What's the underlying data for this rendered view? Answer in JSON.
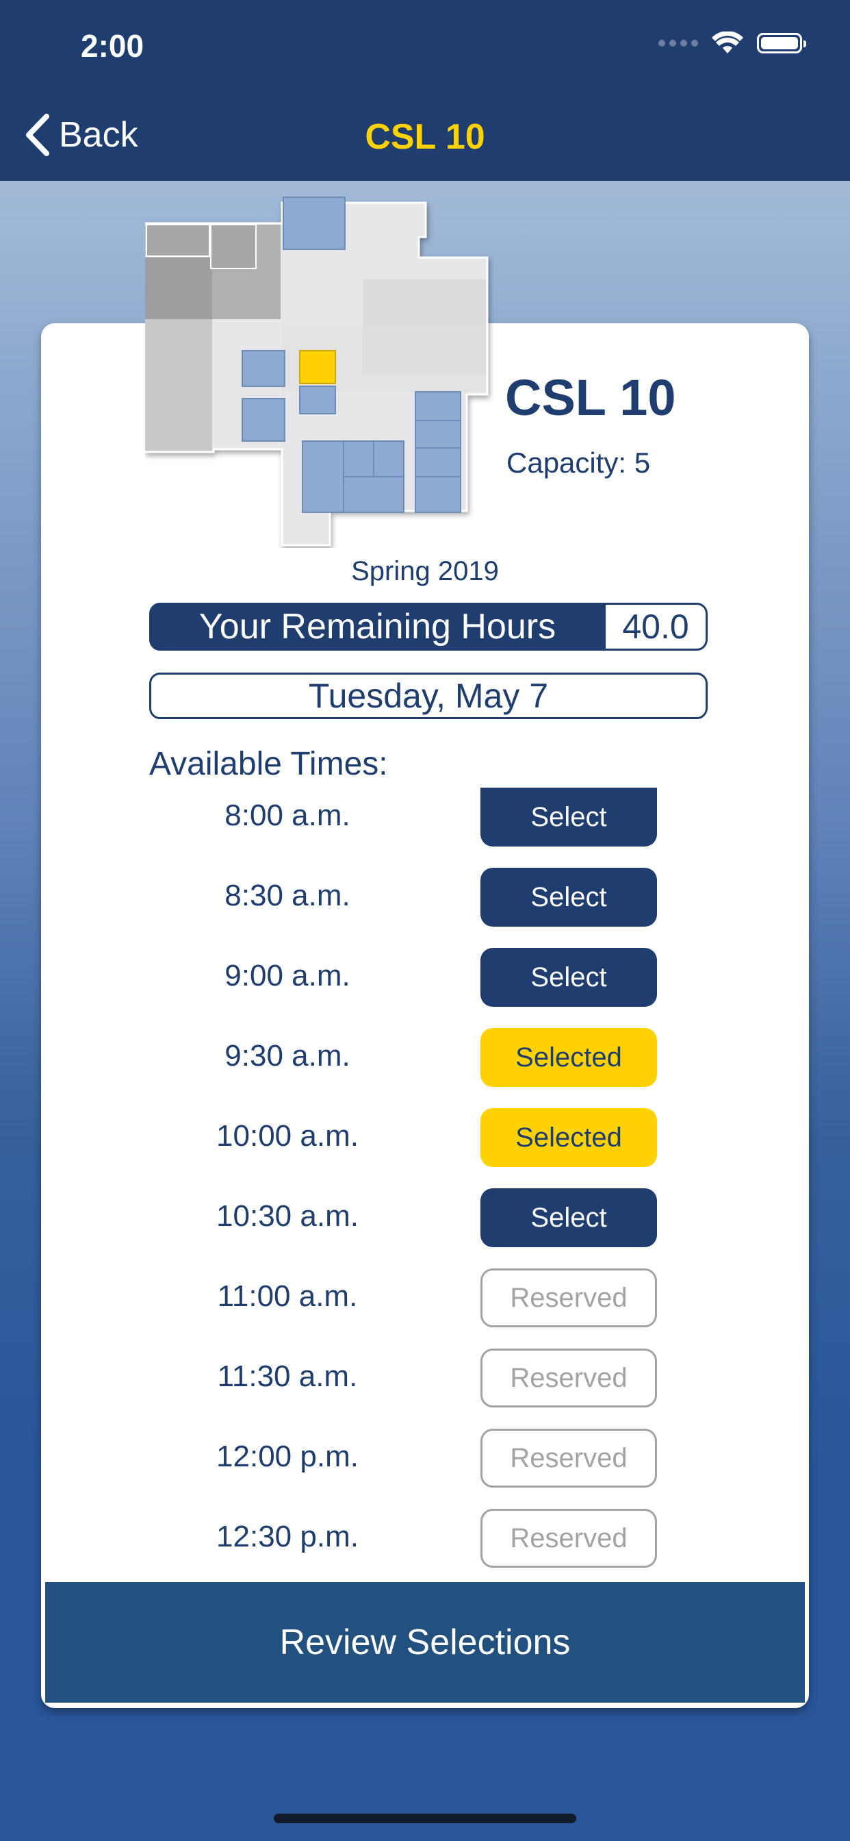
{
  "status_bar": {
    "time": "2:00"
  },
  "nav": {
    "back_label": "Back",
    "title": "CSL 10"
  },
  "room": {
    "name": "CSL 10",
    "capacity": "Capacity: 5"
  },
  "term": "Spring 2019",
  "hours": {
    "label": "Your Remaining Hours",
    "value": "40.0"
  },
  "date": "Tuesday, May 7",
  "available_label": "Available Times:",
  "slots": [
    {
      "time": "8:00 a.m.",
      "status": "Select"
    },
    {
      "time": "8:30 a.m.",
      "status": "Select"
    },
    {
      "time": "9:00 a.m.",
      "status": "Select"
    },
    {
      "time": "9:30 a.m.",
      "status": "Selected"
    },
    {
      "time": "10:00 a.m.",
      "status": "Selected"
    },
    {
      "time": "10:30 a.m.",
      "status": "Select"
    },
    {
      "time": "11:00 a.m.",
      "status": "Reserved"
    },
    {
      "time": "11:30 a.m.",
      "status": "Reserved"
    },
    {
      "time": "12:00 p.m.",
      "status": "Reserved"
    },
    {
      "time": "12:30 p.m.",
      "status": "Reserved"
    }
  ],
  "review_label": "Review Selections",
  "colors": {
    "navy": "#1f3d6e",
    "gold": "#ffd200",
    "reserved_gray": "#a3a3a3",
    "review_blue": "#22507f"
  }
}
